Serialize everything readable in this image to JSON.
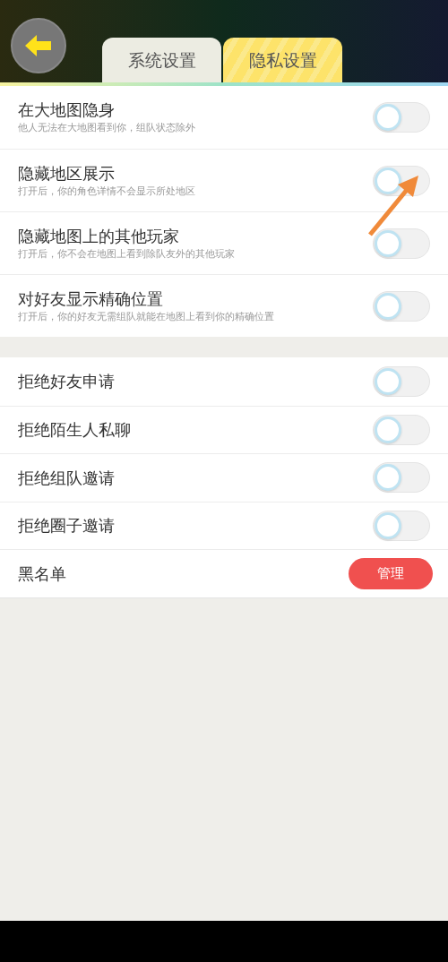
{
  "tabs": [
    {
      "label": "系统设置",
      "selected": false
    },
    {
      "label": "隐私设置",
      "selected": true
    }
  ],
  "map_settings": [
    {
      "title": "在大地图隐身",
      "description": "他人无法在大地图看到你，组队状态除外",
      "on": false
    },
    {
      "title": "隐藏地区展示",
      "description": "打开后，你的角色详情不会显示所处地区",
      "on": false
    },
    {
      "title": "隐藏地图上的其他玩家",
      "description": "打开后，你不会在地图上看到除队友外的其他玩家",
      "on": false
    },
    {
      "title": "对好友显示精确位置",
      "description": "打开后，你的好友无需组队就能在地图上看到你的精确位置",
      "on": false
    }
  ],
  "social_settings": [
    {
      "kind": "toggle",
      "title": "拒绝好友申请",
      "on": false
    },
    {
      "kind": "toggle",
      "title": "拒绝陌生人私聊",
      "on": false
    },
    {
      "kind": "toggle",
      "title": "拒绝组队邀请",
      "on": false
    },
    {
      "kind": "toggle",
      "title": "拒绝圈子邀请",
      "on": false
    },
    {
      "kind": "button",
      "title": "黑名单",
      "button": "管理"
    }
  ]
}
